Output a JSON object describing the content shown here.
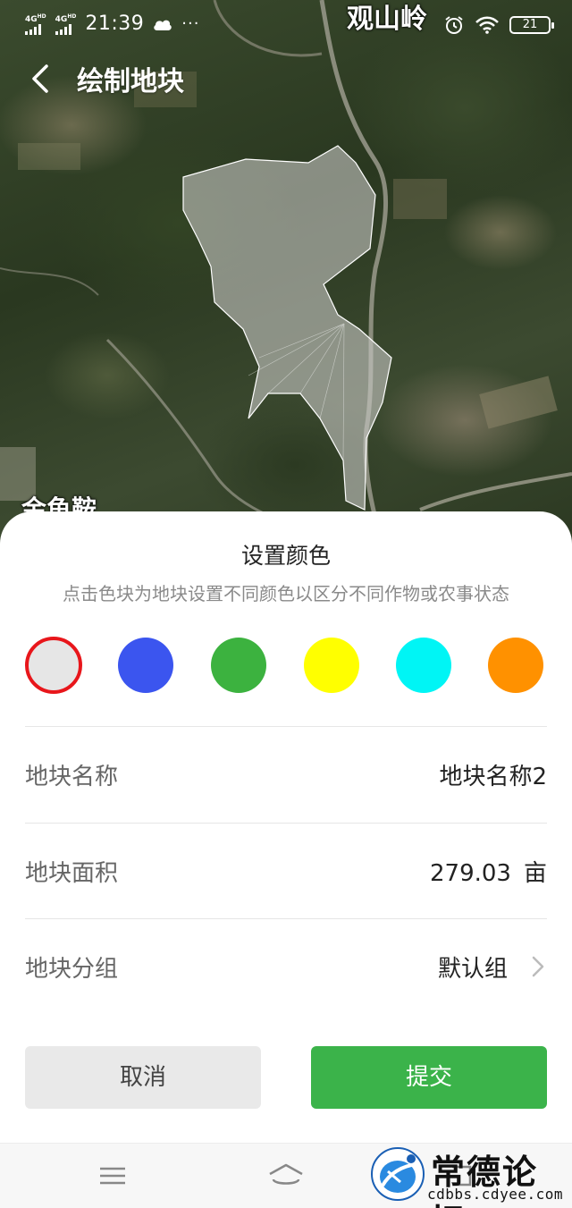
{
  "status_bar": {
    "network1": "4G",
    "network1_hd": "HD",
    "network2": "4G",
    "network2_hd": "HD",
    "time": "21:39",
    "cloud_icon": "cloud-icon",
    "more": "···",
    "battery": "21"
  },
  "header": {
    "back_icon": "chevron-left-icon",
    "title": "绘制地块"
  },
  "map": {
    "place_labels": [
      "观山岭",
      "金鱼鞍"
    ]
  },
  "sheet": {
    "title": "设置颜色",
    "subtitle": "点击色块为地块设置不同颜色以区分不同作物或农事状态",
    "colors": [
      "#e6e6e6",
      "#3b55ef",
      "#3cb23f",
      "#ffff00",
      "#00f5f5",
      "#ff9100"
    ],
    "selected_color_index": 0,
    "selected_ring_color": "#e8161b",
    "fields": [
      {
        "label": "地块名称",
        "value": "地块名称2"
      },
      {
        "label": "地块面积",
        "value": "279.03",
        "unit": "亩"
      },
      {
        "label": "地块分组",
        "value": "默认组"
      }
    ],
    "cancel_label": "取消",
    "submit_label": "提交",
    "submit_color": "#3bb34a"
  },
  "watermark": {
    "title": "常德论坛",
    "url": "cdbbs.cdyee.com"
  }
}
